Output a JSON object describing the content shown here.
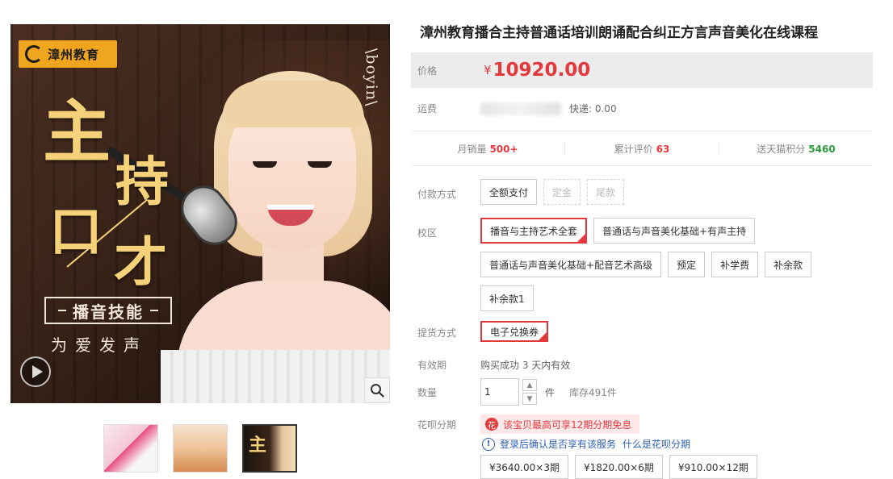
{
  "gallery": {
    "brand": "漳州教育",
    "side_text": "\\boyin\\",
    "title_chars": [
      "主",
      "持",
      "口",
      "才"
    ],
    "skill": "播音技能",
    "slogan": "为爱发声",
    "thumb3_char": "主"
  },
  "product": {
    "title": "漳州教育播合主持普通话培训朗诵配合纠正方言声音美化在线课程",
    "price_label": "价格",
    "currency": "¥",
    "price": "10920.00",
    "shipping_label": "运费",
    "shipping_value": "快递: 0.00"
  },
  "stats": [
    {
      "label": "月销量",
      "value": "500+",
      "color": "red"
    },
    {
      "label": "累计评价",
      "value": "63",
      "color": "red"
    },
    {
      "label": "送天猫积分",
      "value": "5460",
      "color": "green"
    }
  ],
  "payment": {
    "label": "付款方式",
    "options": [
      {
        "text": "全额支付",
        "state": "normal"
      },
      {
        "text": "定金",
        "state": "disabled"
      },
      {
        "text": "尾款",
        "state": "disabled"
      }
    ]
  },
  "campus": {
    "label": "校区",
    "options": [
      {
        "text": "播音与主持艺术全套",
        "state": "selected"
      },
      {
        "text": "普通话与声音美化基础+有声主持",
        "state": "normal"
      },
      {
        "text": "普通话与声音美化基础+配音艺术高级",
        "state": "normal"
      },
      {
        "text": "预定",
        "state": "normal"
      },
      {
        "text": "补学费",
        "state": "normal"
      },
      {
        "text": "补余款",
        "state": "normal"
      },
      {
        "text": "补余款1",
        "state": "normal"
      }
    ]
  },
  "delivery": {
    "label": "提货方式",
    "option": "电子兑换券"
  },
  "validity": {
    "label": "有效期",
    "value": "购买成功 3 天内有效"
  },
  "quantity": {
    "label": "数量",
    "value": "1",
    "unit": "件",
    "stock": "库存491件"
  },
  "huabei": {
    "label": "花呗分期",
    "promo_icon": "花",
    "promo": "该宝贝最高可享12期分期免息",
    "info_icon": "!",
    "notice": "登录后确认是否享有该服务",
    "link": "什么是花呗分期",
    "installments": [
      "¥3640.00×3期",
      "¥1820.00×6期",
      "¥910.00×12期"
    ]
  }
}
